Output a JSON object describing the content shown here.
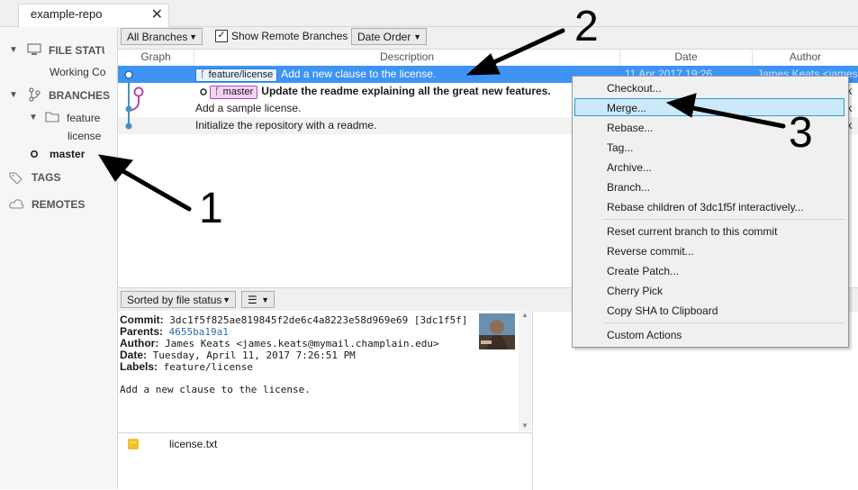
{
  "tab": {
    "title": "example-repo",
    "close": "✕"
  },
  "sidebar": {
    "file_status": "FILE STATUS",
    "working_copy": "Working Copy",
    "branches": "BRANCHES",
    "feature_folder": "feature",
    "license_branch": "license",
    "master_branch": "master",
    "tags": "TAGS",
    "remotes": "REMOTES"
  },
  "toolbar": {
    "branches_dropdown": "All Branches",
    "show_remote": "Show Remote Branches",
    "show_remote_checked": true,
    "order_dropdown": "Date Order"
  },
  "columns": {
    "graph": "Graph",
    "description": "Description",
    "date": "Date",
    "author": "Author"
  },
  "commits": [
    {
      "label": "feature/license",
      "description": "Add a new clause to the license.",
      "date": "11 Apr 2017 19:26",
      "author": "James Keats <james.k"
    },
    {
      "label": "master",
      "description": "Update the readme explaining all the great new features."
    },
    {
      "description": "Add a sample license."
    },
    {
      "description": "Initialize the repository with a readme."
    }
  ],
  "author_fragments": [
    "s.k",
    "s.k",
    "s.k"
  ],
  "lower_toolbar": {
    "sort": "Sorted by file status"
  },
  "details": {
    "commit_label": "Commit:",
    "commit_value": "3dc1f5f825ae819845f2de6c4a8223e58d969e69 [3dc1f5f]",
    "parents_label": "Parents:",
    "parents_value": "4655ba19a1",
    "author_label": "Author:",
    "author_value": "James Keats <james.keats@mymail.champlain.edu>",
    "date_label": "Date:",
    "date_value": "Tuesday, April 11, 2017 7:26:51 PM",
    "labels_label": "Labels:",
    "labels_value": "feature/license",
    "message": "Add a new clause to the license."
  },
  "files": [
    {
      "name": "license.txt",
      "status_color": "#f5c02e"
    }
  ],
  "context_menu": {
    "group1": [
      "Checkout...",
      "Merge...",
      "Rebase...",
      "Tag...",
      "Archive...",
      "Branch...",
      "Rebase children of 3dc1f5f interactively..."
    ],
    "group2": [
      "Reset current branch to this commit",
      "Reverse commit...",
      "Create Patch...",
      "Cherry Pick",
      "Copy SHA to Clipboard"
    ],
    "group3": [
      "Custom Actions"
    ],
    "highlighted": "Merge..."
  },
  "annotations": [
    "1",
    "2",
    "3"
  ],
  "colors": {
    "selection": "#3d94f6",
    "menu_highlight": "#cde8f7",
    "branch_line": "#4a90c2",
    "master_line": "#b04ab0"
  }
}
